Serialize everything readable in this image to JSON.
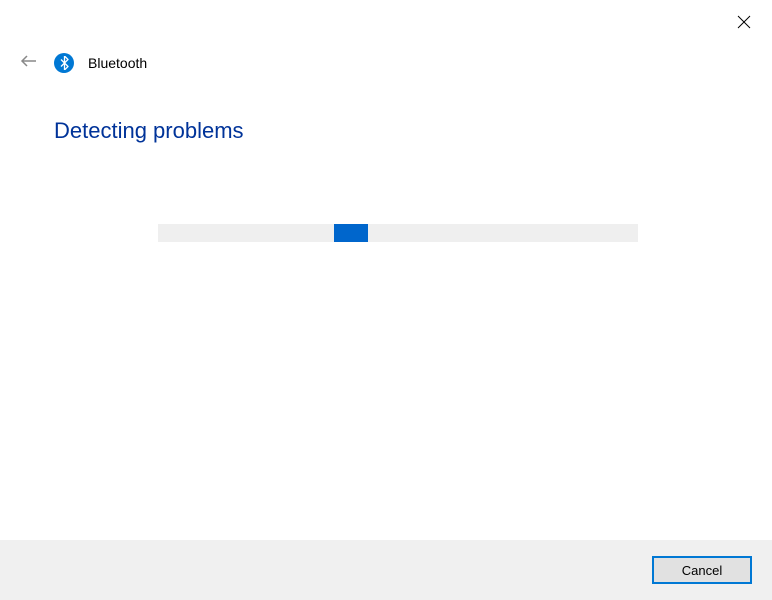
{
  "header": {
    "title": "Bluetooth"
  },
  "main": {
    "heading": "Detecting problems"
  },
  "footer": {
    "cancel_label": "Cancel"
  }
}
